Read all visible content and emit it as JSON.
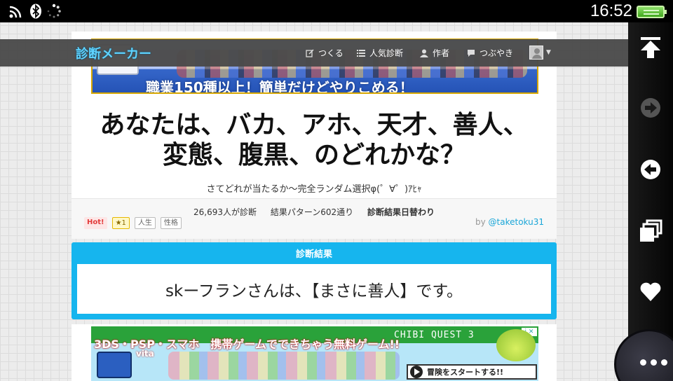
{
  "status_bar": {
    "time": "16:52",
    "icons": [
      "wifi-icon",
      "bluetooth-icon",
      "loading-spinner-icon",
      "battery-icon"
    ]
  },
  "header": {
    "brand": "診断メーカー",
    "nav": [
      {
        "label": "つくる",
        "icon": "edit-icon"
      },
      {
        "label": "人気診断",
        "icon": "list-icon"
      },
      {
        "label": "作者",
        "icon": "person-icon"
      },
      {
        "label": "つぶやき",
        "icon": "speech-bubble-icon"
      }
    ]
  },
  "ad_top": {
    "text": "職業150種以上！簡単だけどやりこめる！"
  },
  "diagnosis": {
    "title": "あなたは、バカ、アホ、天才、善人、変態、腹黒、のどれかな？",
    "subtitle": "さてどれが当たるか～完全ランダム選択φ(゜∀゜)ｱﾋｬ",
    "count": "26,693人が診断",
    "patterns": "結果パターン602通り",
    "daily": "診断結果日替わり",
    "tags": {
      "hot": "Hot!",
      "star": "★1",
      "t1": "人生",
      "t2": "性格"
    },
    "author_prefix": "by",
    "author": "@taketoku31"
  },
  "result": {
    "heading": "診断結果",
    "text": "skーフランさんは、【まさに善人】です。"
  },
  "ad_bottom": {
    "text1": "3DS・PSP・スマホ　携帯ゲームでできちゃう無料ゲーム!!",
    "sub": "vita",
    "quest": "CHIBI QUEST 3",
    "cta": "冒険をスタートする!!"
  },
  "side_panel": {
    "buttons": [
      "scroll-top-icon",
      "forward-icon",
      "back-icon",
      "windows-icon",
      "favorite-heart-icon",
      "more-dots-icon"
    ]
  },
  "colors": {
    "accent": "#16b5ee",
    "brand": "#5fd3ff",
    "navbar": "#4a4a4a",
    "author_link": "#1aa6d8"
  }
}
